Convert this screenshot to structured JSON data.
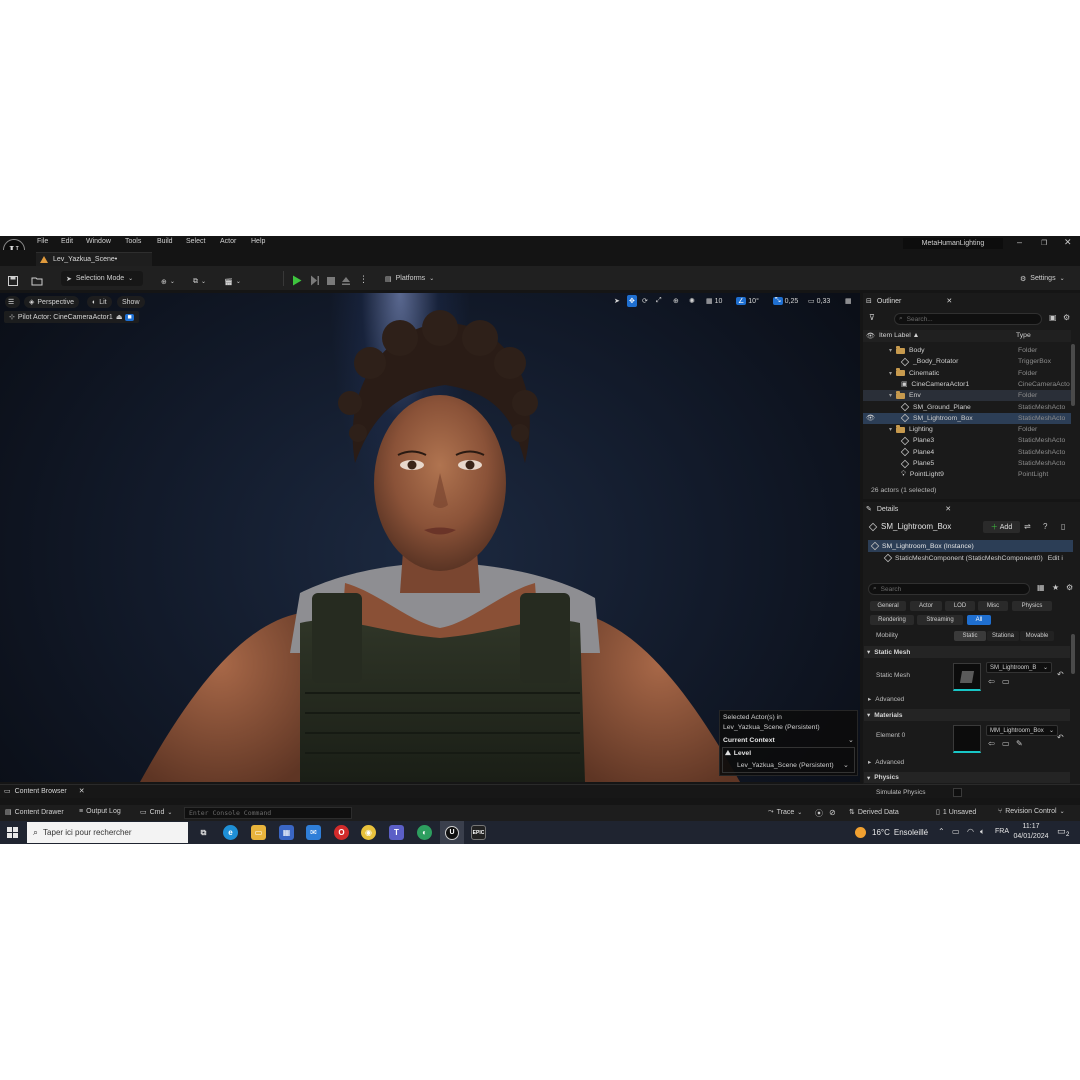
{
  "menubar": {
    "items": [
      "File",
      "Edit",
      "Window",
      "Tools",
      "Build",
      "Select",
      "Actor",
      "Help"
    ],
    "project_title": "MetaHumanLighting",
    "logo": "U"
  },
  "tab": {
    "label": "Lev_Yazkua_Scene•"
  },
  "toolbar": {
    "selection_mode": "Selection Mode",
    "platforms": "Platforms",
    "settings": "Settings"
  },
  "viewport": {
    "perspective": "Perspective",
    "lit": "Lit",
    "show": "Show",
    "pilot_actor": "Pilot Actor: CineCameraActor1",
    "grid_value": "10",
    "angle_value": "10°",
    "scale_value": "0,25",
    "camera_speed": "0,33"
  },
  "selected_overlay": {
    "line1": "Selected Actor(s) in",
    "line2": "Lev_Yazkua_Scene (Persistent)",
    "context_label": "Current Context",
    "level_label": "Level",
    "level_value": "Lev_Yazkua_Scene (Persistent)"
  },
  "outliner": {
    "tab": "Outliner",
    "search_placeholder": "Search...",
    "col_label": "Item Label ▲",
    "col_type": "Type",
    "rows": [
      {
        "name": "Body",
        "type": "Folder",
        "kind": "folder",
        "indent": 1
      },
      {
        "name": "_Body_Rotator",
        "type": "TriggerBox",
        "kind": "mesh",
        "indent": 2
      },
      {
        "name": "Cinematic",
        "type": "Folder",
        "kind": "folder",
        "indent": 1
      },
      {
        "name": "CineCameraActor1",
        "type": "CineCameraActo",
        "kind": "camera",
        "indent": 2
      },
      {
        "name": "Env",
        "type": "Folder",
        "kind": "folder",
        "indent": 1
      },
      {
        "name": "SM_Ground_Plane",
        "type": "StaticMeshActo",
        "kind": "mesh",
        "indent": 2
      },
      {
        "name": "SM_Lightroom_Box",
        "type": "StaticMeshActo",
        "kind": "mesh",
        "indent": 2,
        "selected": true
      },
      {
        "name": "Lighting",
        "type": "Folder",
        "kind": "folder",
        "indent": 1
      },
      {
        "name": "Plane3",
        "type": "StaticMeshActo",
        "kind": "mesh",
        "indent": 2
      },
      {
        "name": "Plane4",
        "type": "StaticMeshActo",
        "kind": "mesh",
        "indent": 2
      },
      {
        "name": "Plane5",
        "type": "StaticMeshActo",
        "kind": "mesh",
        "indent": 2
      },
      {
        "name": "PointLight9",
        "type": "PointLight",
        "kind": "light",
        "indent": 2
      }
    ],
    "footer": "26 actors (1 selected)"
  },
  "details": {
    "tab": "Details",
    "actor_name": "SM_Lightroom_Box",
    "add_label": "Add",
    "instance_label": "SM_Lightroom_Box (Instance)",
    "component_label": "StaticMeshComponent (StaticMeshComponent0)",
    "edit_label": "Edit i",
    "search_placeholder": "Search",
    "filters_row1": [
      "General",
      "Actor",
      "LOD",
      "Misc",
      "Physics"
    ],
    "filters_row2": [
      "Rendering",
      "Streaming",
      "All"
    ],
    "mobility_label": "Mobility",
    "mobility_options": [
      "Static",
      "Stationa",
      "Movable"
    ],
    "static_mesh_section": "Static Mesh",
    "static_mesh_label": "Static Mesh",
    "static_mesh_value": "SM_Lightroom_B",
    "advanced_label": "Advanced",
    "materials_section": "Materials",
    "element0_label": "Element 0",
    "material_value": "MM_Lightroom_Box",
    "advanced2_label": "Advanced",
    "physics_section": "Physics",
    "simulate_physics_label": "Simulate Physics"
  },
  "bottom": {
    "content_browser": "Content Browser",
    "content_drawer": "Content Drawer",
    "output_log": "Output Log",
    "cmd": "Cmd",
    "console_placeholder": "Enter Console Command",
    "trace": "Trace",
    "derived_data": "Derived Data",
    "unsaved": "1 Unsaved",
    "revision_control": "Revision Control"
  },
  "taskbar": {
    "search_placeholder": "Taper ici pour rechercher",
    "weather_temp": "16°C",
    "weather_text": "Ensoleillé",
    "lang": "FRA",
    "time": "11:17",
    "date": "04/01/2024",
    "notif_count": "2"
  },
  "colors": {
    "accent_blue": "#1f6fd0",
    "play_green": "#3ec43e",
    "folder": "#c79a4e",
    "selection_row": "#2c3e56",
    "viewport_bg": "#121a2a"
  }
}
